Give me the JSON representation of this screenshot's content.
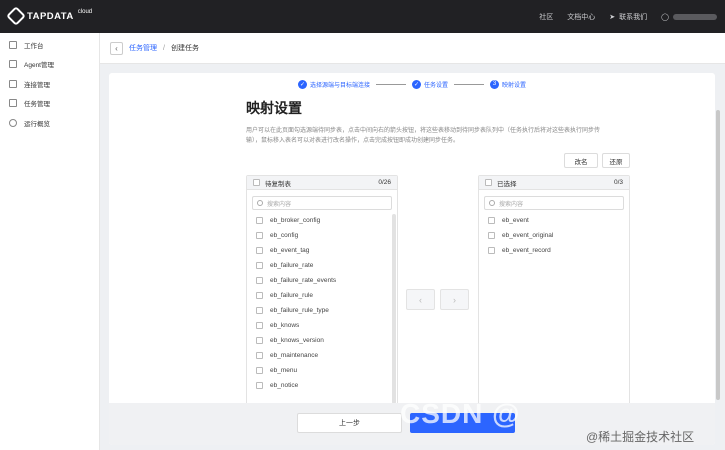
{
  "app": {
    "logo_text": "TAPDATA",
    "logo_suffix": "cloud"
  },
  "topnav": {
    "community": "社区",
    "docs": "文档中心",
    "contact": "联系我们"
  },
  "sidebar": {
    "items": [
      {
        "label": "工作台",
        "icon": "workbench-icon"
      },
      {
        "label": "Agent管理",
        "icon": "agent-icon"
      },
      {
        "label": "连接管理",
        "icon": "connection-icon"
      },
      {
        "label": "任务管理",
        "icon": "task-icon"
      },
      {
        "label": "运行概览",
        "icon": "overview-icon"
      }
    ]
  },
  "breadcrumb": {
    "parent": "任务管理",
    "sep": "/",
    "current": "创建任务"
  },
  "steps": [
    {
      "label": "选择源端与目标端连接",
      "marker": "✓"
    },
    {
      "label": "任务设置",
      "marker": "✓"
    },
    {
      "label": "映射设置",
      "marker": "3"
    }
  ],
  "page": {
    "title": "映射设置",
    "description": "用户可以在此页面勾选源端待同步表，点击中间向右的箭头按钮，将这些表移动到待同步表队列中（任务执行后将对这些表执行同步传输），鼠标移入表名可以对表进行改名操作，点击完成按钮即成功创建同步任务。",
    "btn_cancel": "改名",
    "btn_restore": "还原"
  },
  "left_list": {
    "header": "待复制表",
    "count": "0/26",
    "search_placeholder": "搜索内容",
    "items": [
      "eb_broker_config",
      "eb_config",
      "eb_event_tag",
      "eb_failure_rate",
      "eb_failure_rate_events",
      "eb_failure_rule",
      "eb_failure_rule_type",
      "eb_knows",
      "eb_knows_version",
      "eb_maintenance",
      "eb_menu",
      "eb_notice"
    ]
  },
  "right_list": {
    "header": "已选择",
    "count": "0/3",
    "search_placeholder": "搜索内容",
    "items": [
      "eb_event",
      "eb_event_original",
      "eb_event_record"
    ]
  },
  "footer": {
    "prev": "上一步"
  },
  "watermark": {
    "csdn": "CSDN @",
    "juejin": "@稀土掘金技术社区"
  },
  "colors": {
    "accent": "#2c65ff",
    "topbar": "#212124"
  }
}
